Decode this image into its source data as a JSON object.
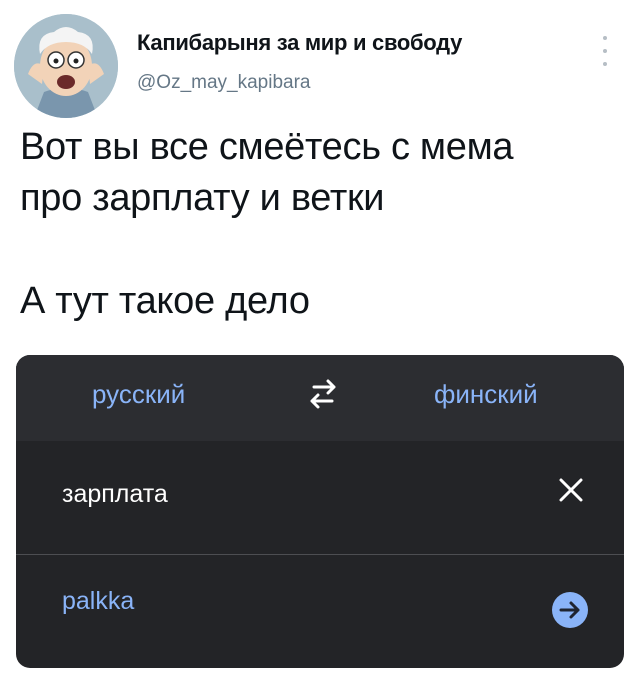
{
  "tweet": {
    "author_name": "Капибарыня за мир и свободу",
    "author_handle": "@Oz_may_kapibara",
    "lines": [
      "Вот вы все смеётесь с мема",
      "про зарплату и ветки",
      "А тут такое дело"
    ]
  },
  "translator": {
    "source_lang": "русский",
    "target_lang": "финский",
    "source_text": "зарплата",
    "result_text": "palkka",
    "accent_color": "#8ab4f8",
    "background_color": "#232427"
  },
  "icons": {
    "avatar": "cartoon-avatar",
    "more": "more-vertical-icon",
    "swap": "swap-languages-icon",
    "clear": "close-icon",
    "go": "arrow-right-circle-icon"
  }
}
